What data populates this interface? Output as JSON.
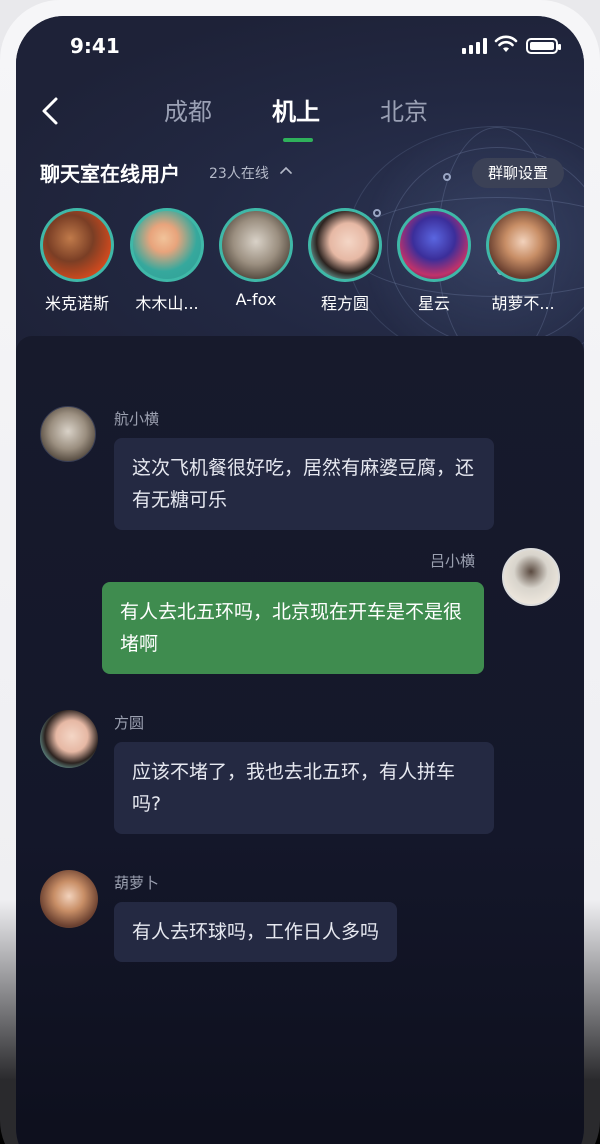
{
  "status": {
    "time": "9:41"
  },
  "nav": {
    "tabs": [
      {
        "label": "成都",
        "active": false
      },
      {
        "label": "机上",
        "active": true
      },
      {
        "label": "北京",
        "active": false
      }
    ]
  },
  "online": {
    "title": "聊天室在线用户",
    "count": "23人在线",
    "group_settings": "群聊设置",
    "users": [
      {
        "name": "米克诺斯"
      },
      {
        "name": "木木山..."
      },
      {
        "name": "A-fox"
      },
      {
        "name": "程方圆"
      },
      {
        "name": "星云"
      },
      {
        "name": "胡萝不..."
      }
    ]
  },
  "messages": [
    {
      "sender": "航小横",
      "text": "这次飞机餐很好吃，居然有麻婆豆腐，还有无糖可乐",
      "mine": false
    },
    {
      "sender": "吕小横",
      "text": "有人去北五环吗，北京现在开车是不是很堵啊",
      "mine": true
    },
    {
      "sender": "方圆",
      "text": "应该不堵了，我也去北五环，有人拼车吗?",
      "mine": false
    },
    {
      "sender": "葫萝卜",
      "text": "有人去环球吗，工作日人多吗",
      "mine": false
    }
  ],
  "colors": {
    "accent": "#2fb15b",
    "bubble_green": "#3f8c4f",
    "bubble_dark": "#242942",
    "background": "#1e2238"
  }
}
